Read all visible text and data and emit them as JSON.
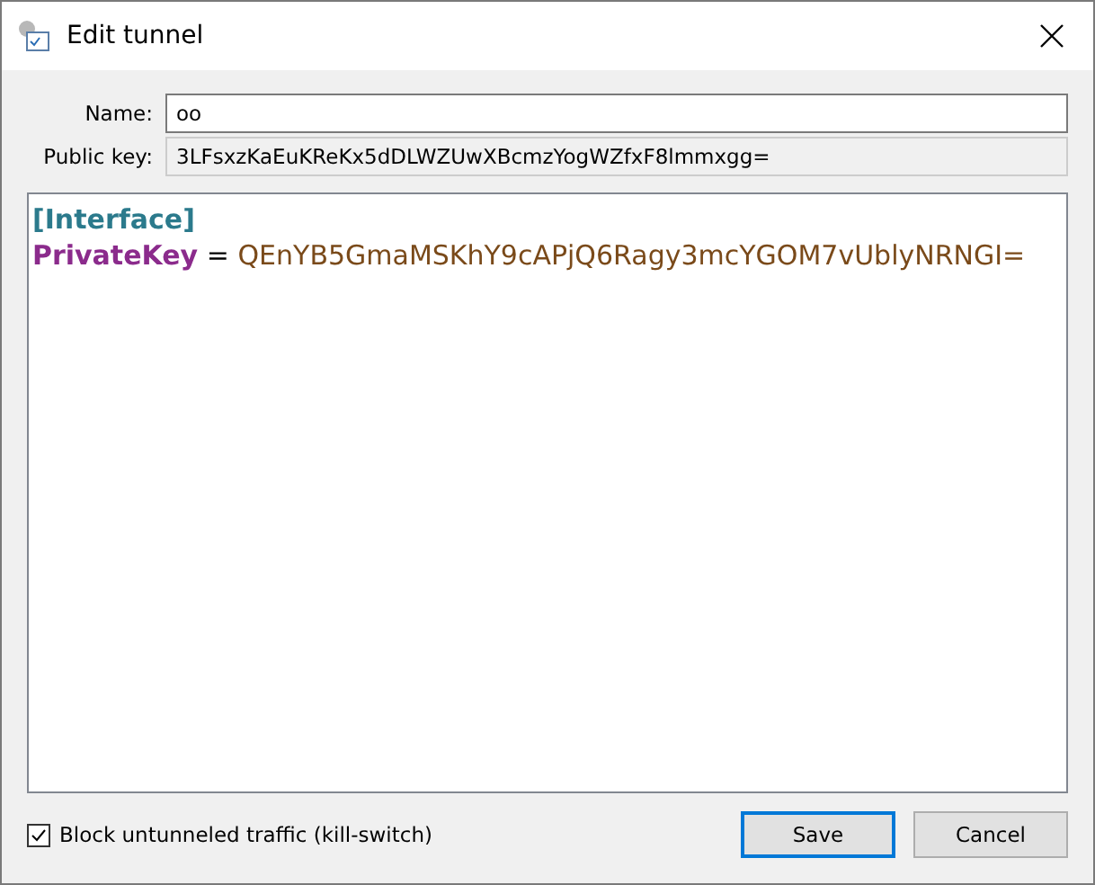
{
  "window": {
    "title": "Edit tunnel"
  },
  "fields": [
    {
      "label": "Name:",
      "value": "oo",
      "readonly": false
    },
    {
      "label": "Public key:",
      "value": "3LFsxzKaEuKReKx5dDLWZUwXBcmzYogWZfxF8lmmxgg=",
      "readonly": true
    }
  ],
  "editor": {
    "lines": [
      {
        "kind": "section",
        "text": "[Interface]"
      },
      {
        "kind": "pair",
        "key": "PrivateKey",
        "separator": "=",
        "value": "QEnYB5GmaMSKhY9cAPjQ6Ragy3mcYGOM7vUblyNRNGI="
      }
    ]
  },
  "kill_switch": {
    "label": "Block untunneled traffic (kill-switch)",
    "checked": true
  },
  "buttons": [
    {
      "label": "Save",
      "default": true
    },
    {
      "label": "Cancel",
      "default": false
    }
  ]
}
